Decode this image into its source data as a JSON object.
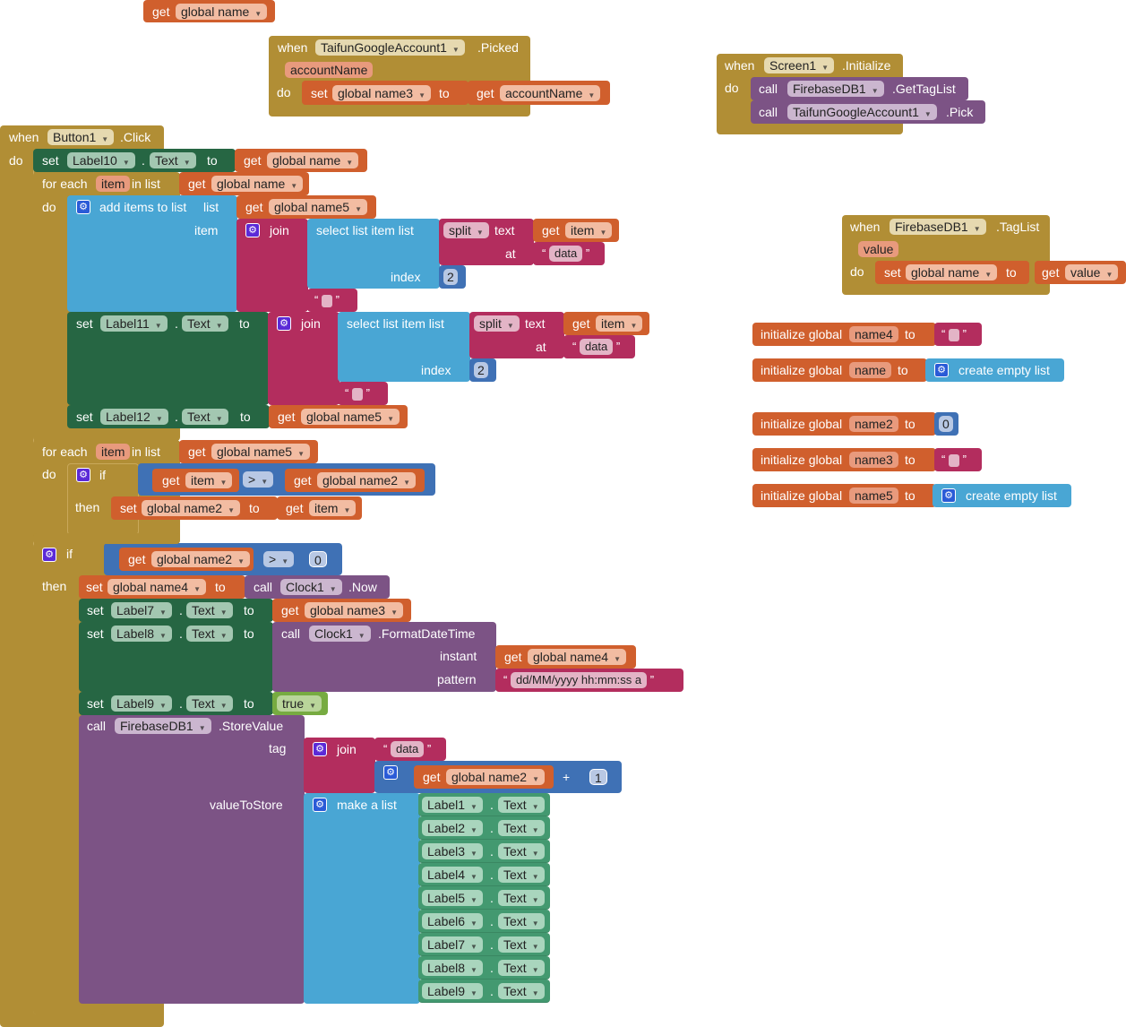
{
  "workspace": {
    "loose_getter": {
      "get": "get",
      "var": "global name"
    },
    "picked_event": {
      "when": "when",
      "component": "TaifunGoogleAccount1",
      "event": ".Picked",
      "param": "accountName",
      "do": "do",
      "set": "set",
      "set_var": "global name3",
      "to": "to",
      "get": "get",
      "get_var": "accountName"
    },
    "init_event": {
      "when": "when",
      "component": "Screen1",
      "event": ".Initialize",
      "do": "do",
      "calls": [
        {
          "call": "call",
          "component": "FirebaseDB1",
          "method": ".GetTagList"
        },
        {
          "call": "call",
          "component": "TaifunGoogleAccount1",
          "method": ".Pick"
        }
      ]
    },
    "taglist_event": {
      "when": "when",
      "component": "FirebaseDB1",
      "event": ".TagList",
      "param": "value",
      "do": "do",
      "set": "set",
      "set_var": "global name",
      "to": "to",
      "get": "get",
      "get_var": "value"
    },
    "globals": [
      {
        "prefix": "initialize global",
        "name": "name4",
        "to": "to",
        "value_type": "text",
        "value": ""
      },
      {
        "prefix": "initialize global",
        "name": "name",
        "to": "to",
        "value_type": "list",
        "value": "create empty list"
      },
      {
        "prefix": "initialize global",
        "name": "name2",
        "to": "to",
        "value_type": "number",
        "value": "0"
      },
      {
        "prefix": "initialize global",
        "name": "name3",
        "to": "to",
        "value_type": "text",
        "value": ""
      },
      {
        "prefix": "initialize global",
        "name": "name5",
        "to": "to",
        "value_type": "list",
        "value": "create empty list"
      }
    ],
    "click_event": {
      "when": "when",
      "component": "Button1",
      "event": ".Click",
      "do": "do",
      "set_label10": {
        "set": "set",
        "comp": "Label10",
        "prop": "Text",
        "to": "to",
        "get": "get",
        "var": "global name"
      },
      "foreach1": {
        "for_each": "for each",
        "item": "item",
        "in_list": "in list",
        "get": "get",
        "var": "global name",
        "do": "do",
        "add_items": {
          "label": "add items to list",
          "list": "list",
          "get": "get",
          "var": "global name5",
          "item": "item"
        },
        "join": "join",
        "select": "select list item  list",
        "split": "split",
        "text": "text",
        "get_item": "get",
        "item_var": "item",
        "at": "at",
        "data": "data",
        "index": "index",
        "index_val": "2",
        "set_label11": {
          "set": "set",
          "comp": "Label11",
          "prop": "Text",
          "to": "to"
        },
        "set_label12": {
          "set": "set",
          "comp": "Label12",
          "prop": "Text",
          "to": "to",
          "get": "get",
          "var": "global name5"
        }
      },
      "foreach2": {
        "for_each": "for each",
        "item": "item",
        "in_list": "in list",
        "get": "get",
        "var": "global name5",
        "do": "do",
        "if": "if",
        "then": "then",
        "cmp_left_get": "get",
        "cmp_left": "item",
        "op": ">",
        "cmp_right_get": "get",
        "cmp_right": "global name2",
        "set": "set",
        "set_var": "global name2",
        "to": "to",
        "get_var": "item"
      },
      "if_block": {
        "if": "if",
        "then": "then",
        "cmp_get": "get",
        "cmp_var": "global name2",
        "op": ">",
        "cmp_val": "0",
        "set_name4": {
          "set": "set",
          "var": "global name4",
          "to": "to",
          "call": "call",
          "comp": "Clock1",
          "method": ".Now"
        },
        "set_label7": {
          "set": "set",
          "comp": "Label7",
          "prop": "Text",
          "to": "to",
          "get": "get",
          "var": "global name3"
        },
        "set_label8": {
          "set": "set",
          "comp": "Label8",
          "prop": "Text",
          "to": "to",
          "call": "call",
          "clock": "Clock1",
          "method": ".FormatDateTime",
          "instant": "instant",
          "get": "get",
          "var": "global name4",
          "pattern": "pattern",
          "pattern_val": "dd/MM/yyyy hh:mm:ss a"
        },
        "set_label9": {
          "set": "set",
          "comp": "Label9",
          "prop": "Text",
          "to": "to",
          "value": "true"
        },
        "store": {
          "call": "call",
          "comp": "FirebaseDB1",
          "method": ".StoreValue",
          "tag": "tag",
          "join": "join",
          "data": "data",
          "get": "get",
          "var": "global name2",
          "plus": "+",
          "num": "1",
          "value_to_store": "valueToStore",
          "make_list": "make a list",
          "items": [
            {
              "comp": "Label1",
              "prop": "Text"
            },
            {
              "comp": "Label2",
              "prop": "Text"
            },
            {
              "comp": "Label3",
              "prop": "Text"
            },
            {
              "comp": "Label4",
              "prop": "Text"
            },
            {
              "comp": "Label5",
              "prop": "Text"
            },
            {
              "comp": "Label6",
              "prop": "Text"
            },
            {
              "comp": "Label7",
              "prop": "Text"
            },
            {
              "comp": "Label8",
              "prop": "Text"
            },
            {
              "comp": "Label9",
              "prop": "Text"
            }
          ]
        }
      }
    }
  },
  "icons": {
    "gear": "⚙",
    "dropdown": "▾",
    "open_quote": "“",
    "close_quote": "”"
  }
}
